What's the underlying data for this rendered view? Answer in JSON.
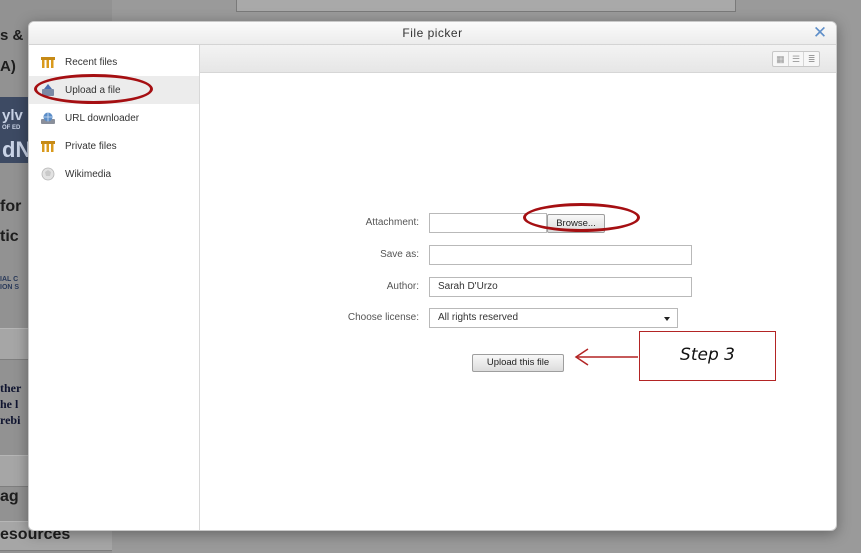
{
  "background": {
    "fragments": [
      "s &",
      "A)",
      "for",
      "tic",
      "ther",
      "he l",
      "rebi",
      "ag",
      "esources"
    ],
    "logo_text": [
      "ylv",
      "OF ED",
      "dN"
    ],
    "small_text": [
      "IAL C",
      "ION S"
    ]
  },
  "dialog": {
    "title": "File picker",
    "close_icon": "close-icon",
    "sidebar": {
      "items": [
        {
          "label": "Recent files",
          "icon": "recent-files-icon"
        },
        {
          "label": "Upload a file",
          "icon": "upload-icon"
        },
        {
          "label": "URL downloader",
          "icon": "url-downloader-icon"
        },
        {
          "label": "Private files",
          "icon": "private-files-icon"
        },
        {
          "label": "Wikimedia",
          "icon": "wikimedia-icon"
        }
      ],
      "active_index": 1
    },
    "toolbar": {
      "view_modes": [
        "icons-view-icon",
        "list-view-icon",
        "tree-view-icon"
      ]
    },
    "form": {
      "attachment_label": "Attachment:",
      "browse_label": "Browse...",
      "save_as_label": "Save as:",
      "save_as_value": "",
      "author_label": "Author:",
      "author_value": "Sarah D'Urzo",
      "license_label": "Choose license:",
      "license_value": "All rights reserved",
      "upload_button_label": "Upload this file"
    }
  },
  "annotation": {
    "step_label": "Step 3",
    "color": "#a50f12"
  }
}
